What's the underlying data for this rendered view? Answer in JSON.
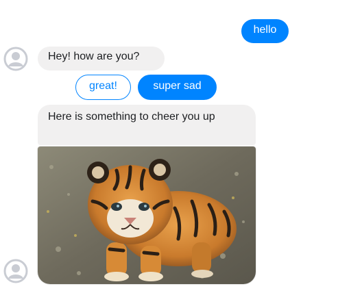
{
  "colors": {
    "accent": "#0084ff",
    "incoming_bubble": "#f1f0f0",
    "avatar": "#c9ccd3"
  },
  "messages": {
    "outgoing_1": "hello",
    "incoming_1": "Hey! how are you?",
    "incoming_2": "Here is something to cheer you up"
  },
  "quick_replies": {
    "great": "great!",
    "super_sad": "super sad"
  },
  "attachment": {
    "icon": "tiger-cub-photo"
  },
  "avatars": {
    "icon": "user-avatar-icon"
  }
}
